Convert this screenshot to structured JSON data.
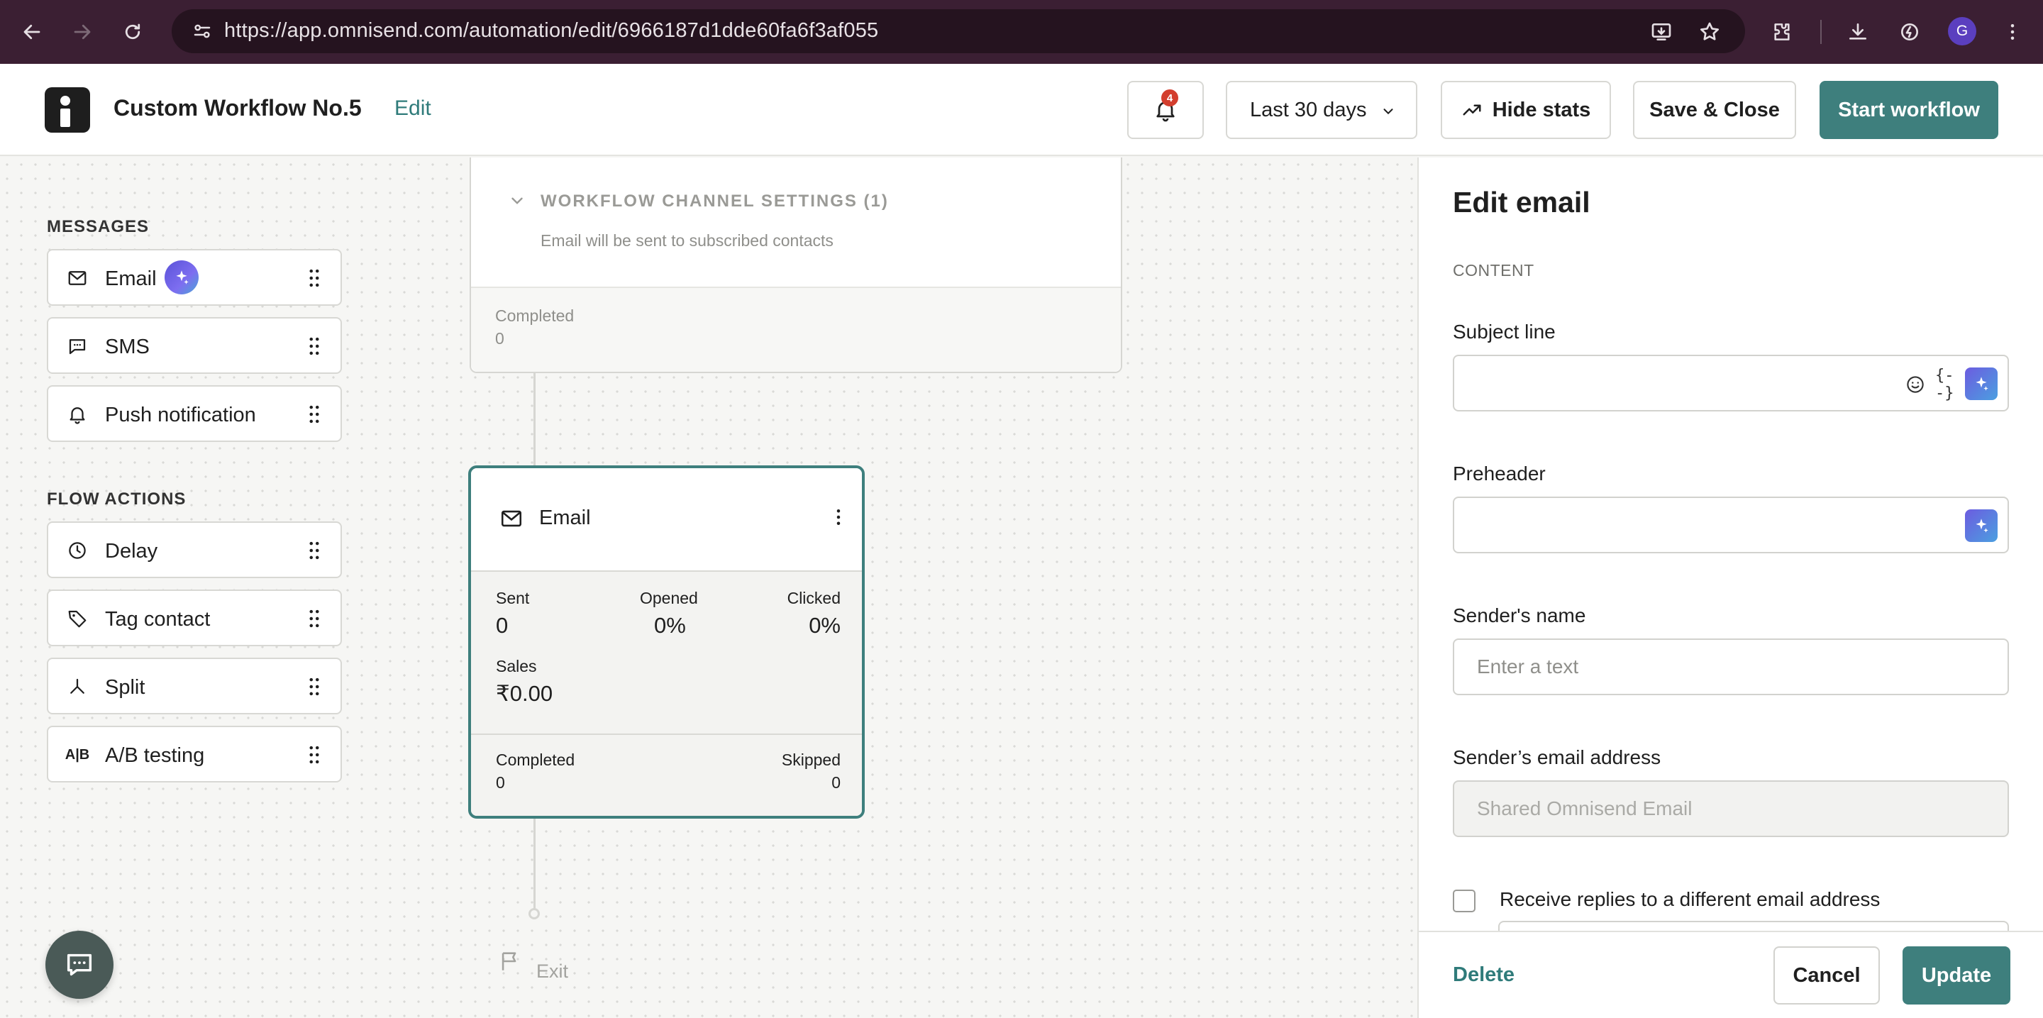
{
  "browser": {
    "url": "https://app.omnisend.com/automation/edit/6966187d1dde60fa6f3af055",
    "profile_initial": "G"
  },
  "header": {
    "workflow_title": "Custom Workflow No.5",
    "edit_label": "Edit",
    "notification_count": "4",
    "date_range": "Last 30 days",
    "hide_stats_label": "Hide stats",
    "save_close_label": "Save & Close",
    "start_workflow_label": "Start workflow"
  },
  "palette": {
    "messages_heading": "MESSAGES",
    "messages": [
      {
        "label": "Email",
        "icon": "mail-icon"
      },
      {
        "label": "SMS",
        "icon": "chat-bubble-icon"
      },
      {
        "label": "Push notification",
        "icon": "bell-icon"
      }
    ],
    "flow_actions_heading": "FLOW ACTIONS",
    "flow_actions": [
      {
        "label": "Delay",
        "icon": "clock-icon"
      },
      {
        "label": "Tag contact",
        "icon": "tag-icon"
      },
      {
        "label": "Split",
        "icon": "split-icon"
      },
      {
        "label": "A/B testing",
        "icon": "ab-icon"
      }
    ]
  },
  "canvas": {
    "settings_card": {
      "title": "WORKFLOW CHANNEL SETTINGS (1)",
      "subtitle": "Email will be sent to subscribed contacts",
      "completed_label": "Completed",
      "completed_value": "0"
    },
    "email_node": {
      "title": "Email",
      "sent_label": "Sent",
      "sent_value": "0",
      "opened_label": "Opened",
      "opened_value": "0%",
      "clicked_label": "Clicked",
      "clicked_value": "0%",
      "sales_label": "Sales",
      "sales_value": "₹0.00",
      "completed_label": "Completed",
      "completed_value": "0",
      "skipped_label": "Skipped",
      "skipped_value": "0"
    },
    "exit_label": "Exit"
  },
  "panel": {
    "title": "Edit email",
    "section_label": "CONTENT",
    "subject_label": "Subject line",
    "subject_value": "",
    "vars_glyph": "{--}",
    "preheader_label": "Preheader",
    "preheader_value": "",
    "sender_name_label": "Sender's name",
    "sender_name_placeholder": "Enter a text",
    "sender_email_label": "Sender’s email address",
    "sender_email_value": "Shared Omnisend Email",
    "reply_checkbox_label": "Receive replies to a different email address",
    "delete_label": "Delete",
    "cancel_label": "Cancel",
    "update_label": "Update"
  },
  "colors": {
    "primary": "#3e7f7d",
    "browser_chrome": "#3b1f33",
    "badge": "#d33e2e"
  }
}
